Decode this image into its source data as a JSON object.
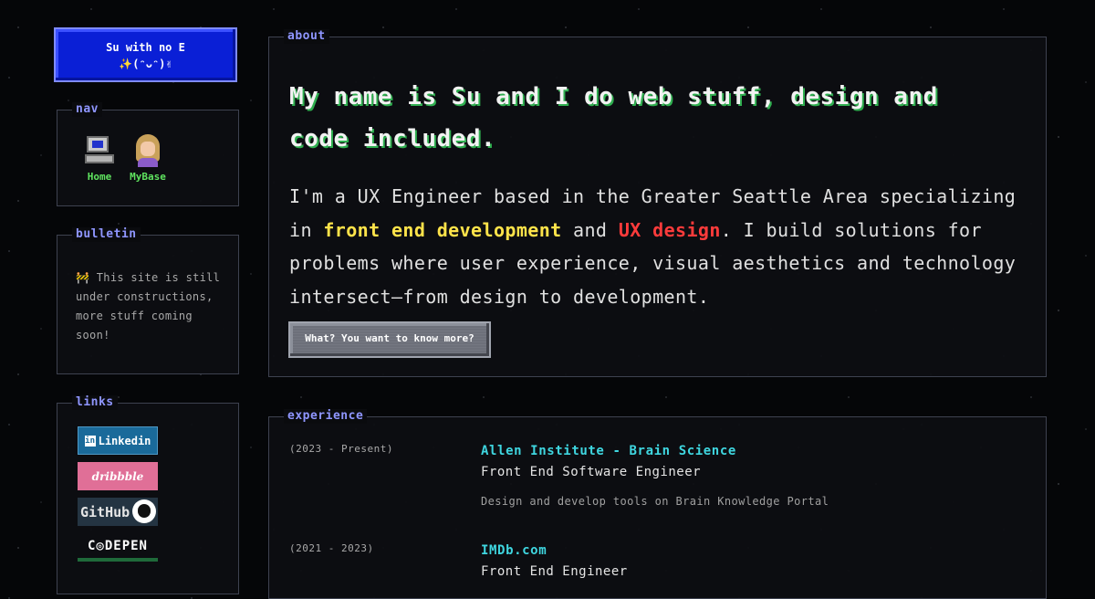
{
  "logo": {
    "line1": "Su with no E",
    "line2": "✨(ᵔᴗᵔ)✌"
  },
  "nav": {
    "legend": "nav",
    "items": [
      {
        "label": "Home",
        "icon": "computer-icon"
      },
      {
        "label": "MyBase",
        "icon": "avatar-icon"
      }
    ]
  },
  "bulletin": {
    "legend": "bulletin",
    "text": "🚧 This site is still under constructions, more stuff coming soon!"
  },
  "links": {
    "legend": "links",
    "items": [
      {
        "label": "Linkedin",
        "icon": "linkedin-icon"
      },
      {
        "label": "dribbble"
      },
      {
        "label": "GitHub",
        "icon": "octocat-icon"
      },
      {
        "label": "C◎DEPEN"
      }
    ]
  },
  "about": {
    "legend": "about",
    "headline": "My name is Su and I do web stuff, design and code included.",
    "intro_1": "I'm a UX Engineer based in the Greater Seattle Area specializing in ",
    "highlight_1": "front end development",
    "intro_2": " and ",
    "highlight_2": "UX design",
    "intro_3": ". I build solutions for problems where user experience, visual aesthetics and technology intersect—from design to development.",
    "button": "What? You want to know more?"
  },
  "experience": {
    "legend": "experience",
    "entries": [
      {
        "date": "(2023 - Present)",
        "company": "Allen Institute - Brain Science",
        "role": "Front End Software Engineer",
        "desc": "Design and develop tools on Brain Knowledge Portal"
      },
      {
        "date": "(2021 - 2023)",
        "company": "IMDb.com",
        "role": "Front End Engineer"
      }
    ]
  },
  "colors": {
    "accent_blue": "#0a1fd6",
    "legend": "#8f96ff",
    "highlight_yellow": "#ffe34a",
    "highlight_red": "#ff3b3b",
    "company_cyan": "#3fd6e0",
    "nav_green": "#5fe35f"
  }
}
